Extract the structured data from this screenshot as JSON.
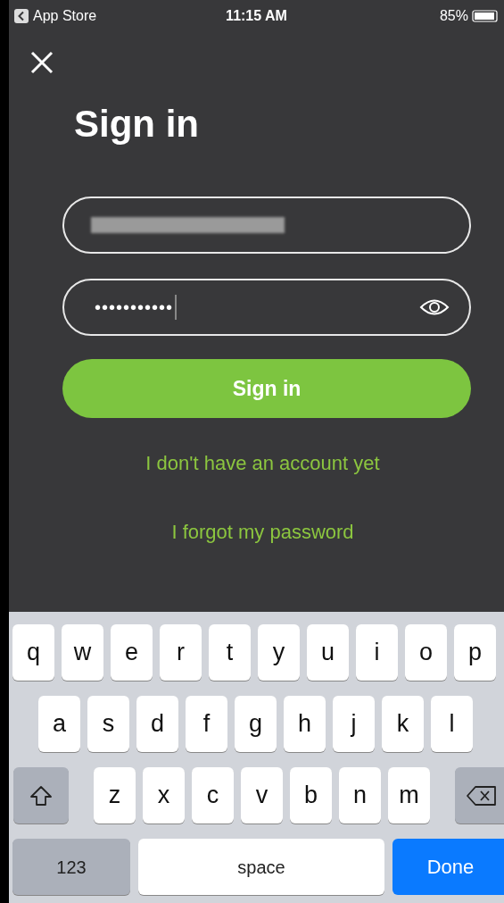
{
  "status_bar": {
    "back_label": "App Store",
    "time": "11:15 AM",
    "battery": "85%"
  },
  "title": "Sign in",
  "password_field": {
    "value": "•••••••••••"
  },
  "sign_in_button": "Sign in",
  "links": [
    "I don't have an account yet",
    "I forgot my password"
  ],
  "keyboard": {
    "rows": [
      {
        "keys": [
          {
            "kind": "letter",
            "label": "q"
          },
          {
            "kind": "letter",
            "label": "w"
          },
          {
            "kind": "letter",
            "label": "e"
          },
          {
            "kind": "letter",
            "label": "r"
          },
          {
            "kind": "letter",
            "label": "t"
          },
          {
            "kind": "letter",
            "label": "y"
          },
          {
            "kind": "letter",
            "label": "u"
          },
          {
            "kind": "letter",
            "label": "i"
          },
          {
            "kind": "letter",
            "label": "o"
          },
          {
            "kind": "letter",
            "label": "p"
          }
        ]
      },
      {
        "keys": [
          {
            "kind": "letter",
            "label": "a"
          },
          {
            "kind": "letter",
            "label": "s"
          },
          {
            "kind": "letter",
            "label": "d"
          },
          {
            "kind": "letter",
            "label": "f"
          },
          {
            "kind": "letter",
            "label": "g"
          },
          {
            "kind": "letter",
            "label": "h"
          },
          {
            "kind": "letter",
            "label": "j"
          },
          {
            "kind": "letter",
            "label": "k"
          },
          {
            "kind": "letter",
            "label": "l"
          }
        ]
      },
      {
        "keys": [
          {
            "kind": "shift"
          },
          {
            "kind": "letter",
            "label": "z"
          },
          {
            "kind": "letter",
            "label": "x"
          },
          {
            "kind": "letter",
            "label": "c"
          },
          {
            "kind": "letter",
            "label": "v"
          },
          {
            "kind": "letter",
            "label": "b"
          },
          {
            "kind": "letter",
            "label": "n"
          },
          {
            "kind": "letter",
            "label": "m"
          },
          {
            "kind": "delete"
          }
        ]
      },
      {
        "keys": [
          {
            "kind": "mode",
            "label": "123"
          },
          {
            "kind": "space",
            "label": "space"
          },
          {
            "kind": "done",
            "label": "Done"
          }
        ]
      }
    ]
  }
}
